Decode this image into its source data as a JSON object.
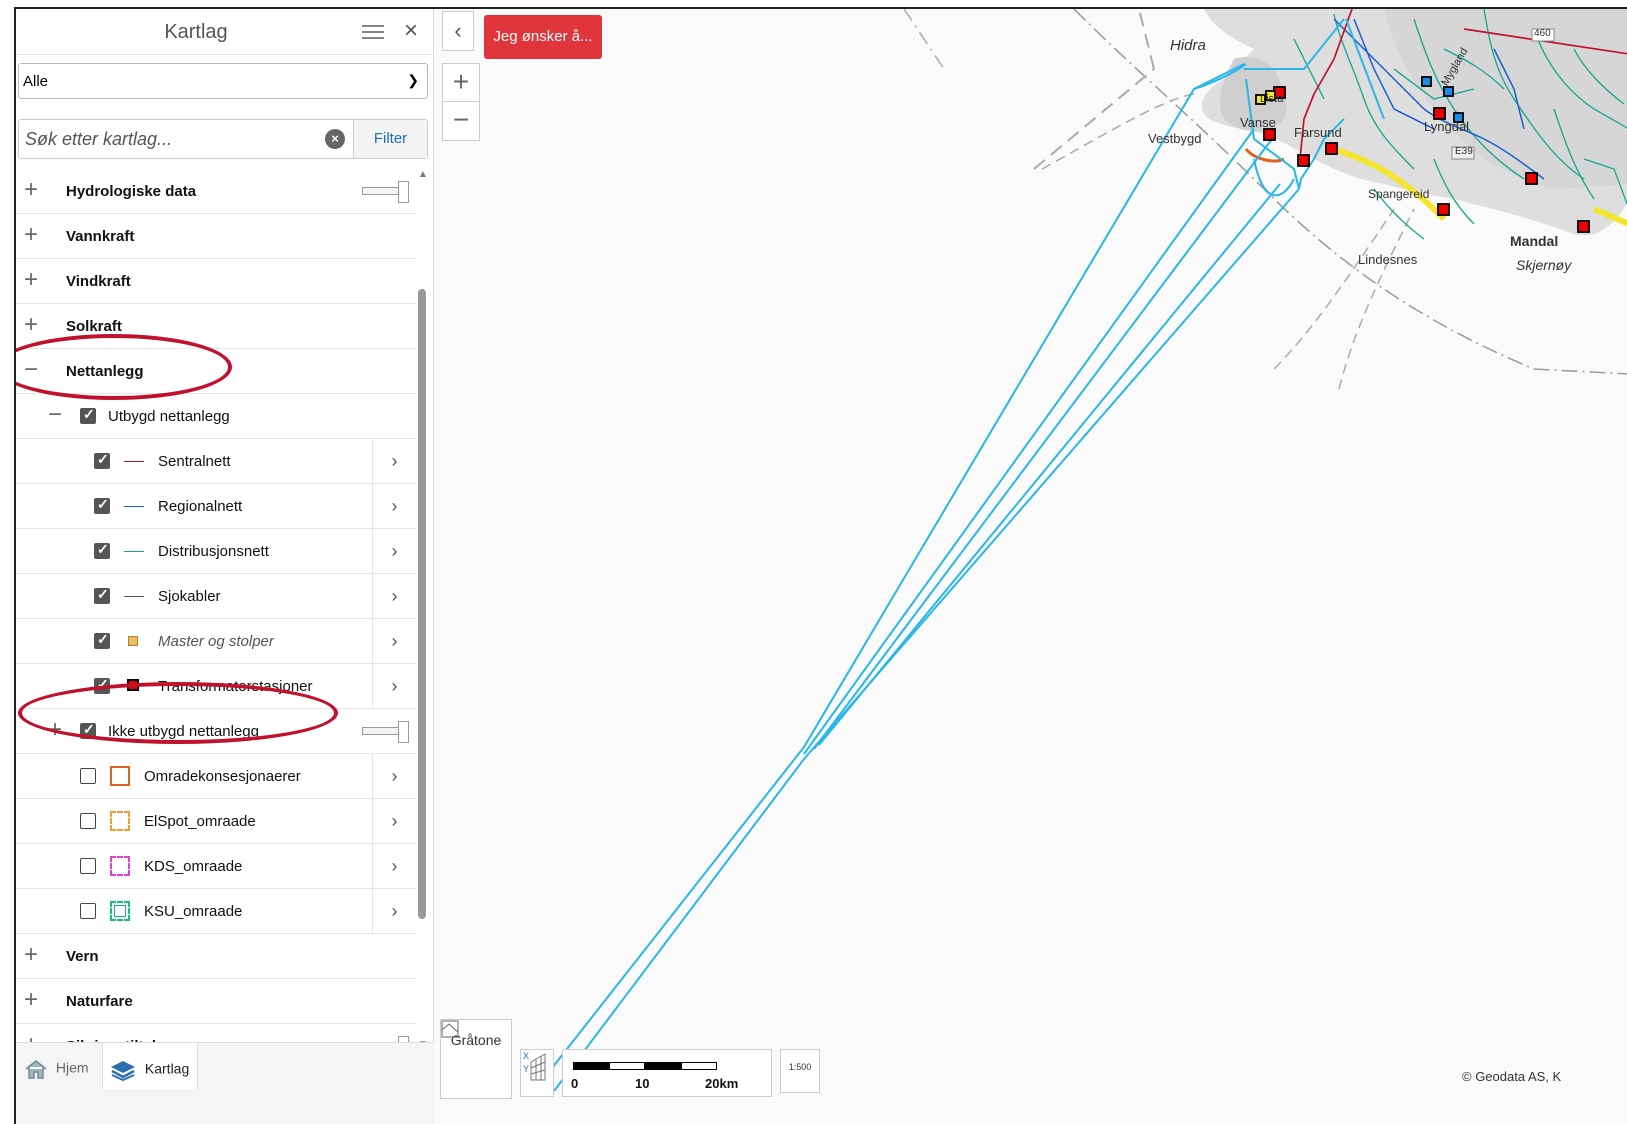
{
  "panel": {
    "title": "Kartlag",
    "select_value": "Alle",
    "search_placeholder": "Søk etter kartlag...",
    "filter_label": "Filter"
  },
  "layers": {
    "hydro": "Hydrologiske data",
    "vannkraft": "Vannkraft",
    "vindkraft": "Vindkraft",
    "solkraft": "Solkraft",
    "nettanlegg": "Nettanlegg",
    "utbygd": "Utbygd nettanlegg",
    "sentralnett": "Sentralnett",
    "regionalnett": "Regionalnett",
    "distribusjonsnett": "Distribusjonsnett",
    "sjokabler": "Sjokabler",
    "master": "Master og stolper",
    "transformator": "Transformatorstasjoner",
    "ikke_utbygd": "Ikke utbygd nettanlegg",
    "omradekonsesjon": "Omradekonsesjonaerer",
    "elspot": "ElSpot_omraade",
    "kds": "KDS_omraade",
    "ksu": "KSU_omraade",
    "vern": "Vern",
    "naturfare": "Naturfare",
    "sikringstiltak": "Sikringstiltak"
  },
  "colors": {
    "sentralnett": "#c0112d",
    "regionalnett": "#1a5fd0",
    "distribusjonsnett": "#14a88a",
    "sjokabler": "#555555",
    "omradekonsesjon": "#e06020",
    "elspot": "#f0a030",
    "kds": "#e040d0",
    "ksu": "#10c080",
    "cable": "#29b6e8",
    "highlight": "#c0112d"
  },
  "tabs": {
    "home": "Hjem",
    "kartlag": "Kartlag"
  },
  "map": {
    "action_button": "Jeg ønsker å...",
    "gratone": "Gråtone",
    "scale": {
      "l0": "0",
      "l1": "10",
      "l2": "20km"
    },
    "scale_ratio": "1:500",
    "copyright": "© Geodata AS, K",
    "places": {
      "hidra": "Hidra",
      "vestbygd": "Vestbygd",
      "farsund": "Farsund",
      "vanse": "Vanse",
      "lista": "Lista",
      "lyngdal": "Lyngdal",
      "spangereid": "Spangereid",
      "lindesnes": "Lindesnes",
      "mandal": "Mandal",
      "skjernoy": "Skjernøy",
      "mygland": "Mygland",
      "route_460": "460",
      "route_e39": "E39"
    }
  }
}
